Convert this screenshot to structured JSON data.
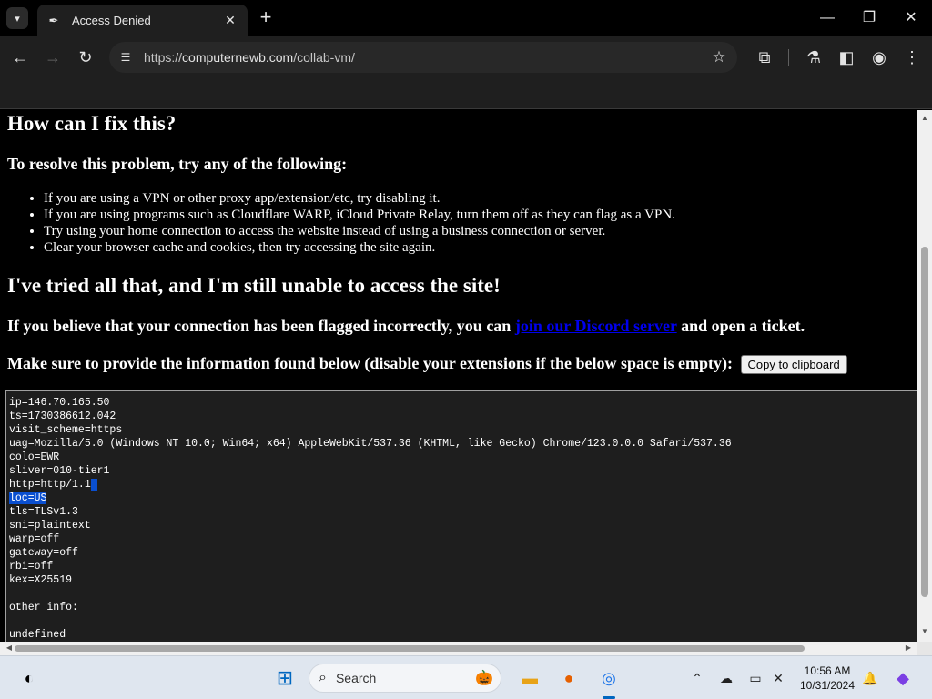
{
  "browser": {
    "tab": {
      "title": "Access Denied",
      "favicon": "pen-nib-icon"
    },
    "url": {
      "scheme": "https://",
      "host": "computernewb.com",
      "path": "/collab-vm/"
    }
  },
  "page": {
    "heading_fix": "How can I fix this?",
    "resolve_intro": "To resolve this problem, try any of the following:",
    "fixes": [
      "If you are using a VPN or other proxy app/extension/etc, try disabling it.",
      "If you are using programs such as Cloudflare WARP, iCloud Private Relay, turn them off as they can flag as a VPN.",
      "Try using your home connection to access the website instead of using a business connection or server.",
      "Clear your browser cache and cookies, then try accessing the site again."
    ],
    "heading_tried": "I've tried all that, and I'm still unable to access the site!",
    "flagged_pre": "If you believe that your connection has been flagged incorrectly, you can ",
    "flagged_link": "join our Discord server",
    "flagged_post": " and open a ticket.",
    "provide_info": "Make sure to provide the information found below (disable your extensions if the below space is empty):",
    "copy_button": "Copy to clipboard",
    "info_lines": [
      "ip=146.70.165.50",
      "ts=1730386612.042",
      "visit_scheme=https",
      "uag=Mozilla/5.0 (Windows NT 10.0; Win64; x64) AppleWebKit/537.36 (KHTML, like Gecko) Chrome/123.0.0.0 Safari/537.36",
      "colo=EWR",
      "sliver=010-tier1",
      "http=http/1.1",
      "loc=US",
      "tls=TLSv1.3",
      "sni=plaintext",
      "warp=off",
      "gateway=off",
      "rbi=off",
      "kex=X25519",
      "",
      "other info:",
      "",
      "undefined"
    ]
  },
  "taskbar": {
    "search_placeholder": "Search",
    "time": "10:56 AM",
    "date": "10/31/2024"
  },
  "colors": {
    "link": "#0000ee",
    "selection": "#0a4fd0",
    "page_bg": "#000000"
  }
}
